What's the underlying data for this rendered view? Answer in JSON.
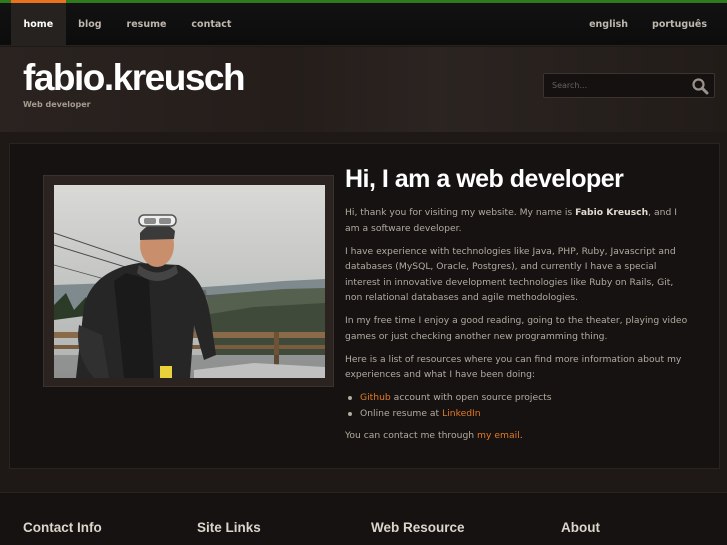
{
  "nav": {
    "left": [
      {
        "label": "home",
        "active": true
      },
      {
        "label": "blog",
        "active": false
      },
      {
        "label": "resume",
        "active": false
      },
      {
        "label": "contact",
        "active": false
      }
    ],
    "right": [
      {
        "label": "english"
      },
      {
        "label": "português"
      }
    ]
  },
  "header": {
    "logo": "fabio.kreusch",
    "tagline": "Web developer",
    "search_placeholder": "Search...",
    "search_icon": "magnifier-icon"
  },
  "photo": {
    "description_icon": "portrait-photo"
  },
  "article": {
    "title": "Hi, I am a web developer",
    "intro_before": "Hi, thank you for visiting my website. My name is ",
    "intro_name": "Fabio Kreusch",
    "intro_after": ", and I am a software developer.",
    "p2": "I have experience with technologies like Java, PHP, Ruby, Javascript and databases (MySQL, Oracle, Postgres), and currently I have a special interest in innovative development technologies like Ruby on Rails, Git, non relational databases and agile methodologies.",
    "p3": "In my free time I enjoy a good reading, going to the theater, playing video games or just checking another new programming thing.",
    "p4": "Here is a list of resources where you can find more information about my experiences and what I have been doing:",
    "list": [
      {
        "link": "Github",
        "text": " account with open source projects",
        "link_first": true
      },
      {
        "text": "Online resume at ",
        "link": "LinkedIn",
        "link_first": false
      }
    ],
    "contact_before": "You can contact me through ",
    "contact_link": "my email",
    "contact_after": "."
  },
  "footer": {
    "headings": [
      "Contact Info",
      "Site Links",
      "Web Resource",
      "About"
    ]
  },
  "colors": {
    "accent": "#e9721c",
    "top_stripe": "#2f7a1f",
    "link": "#e07a24"
  }
}
